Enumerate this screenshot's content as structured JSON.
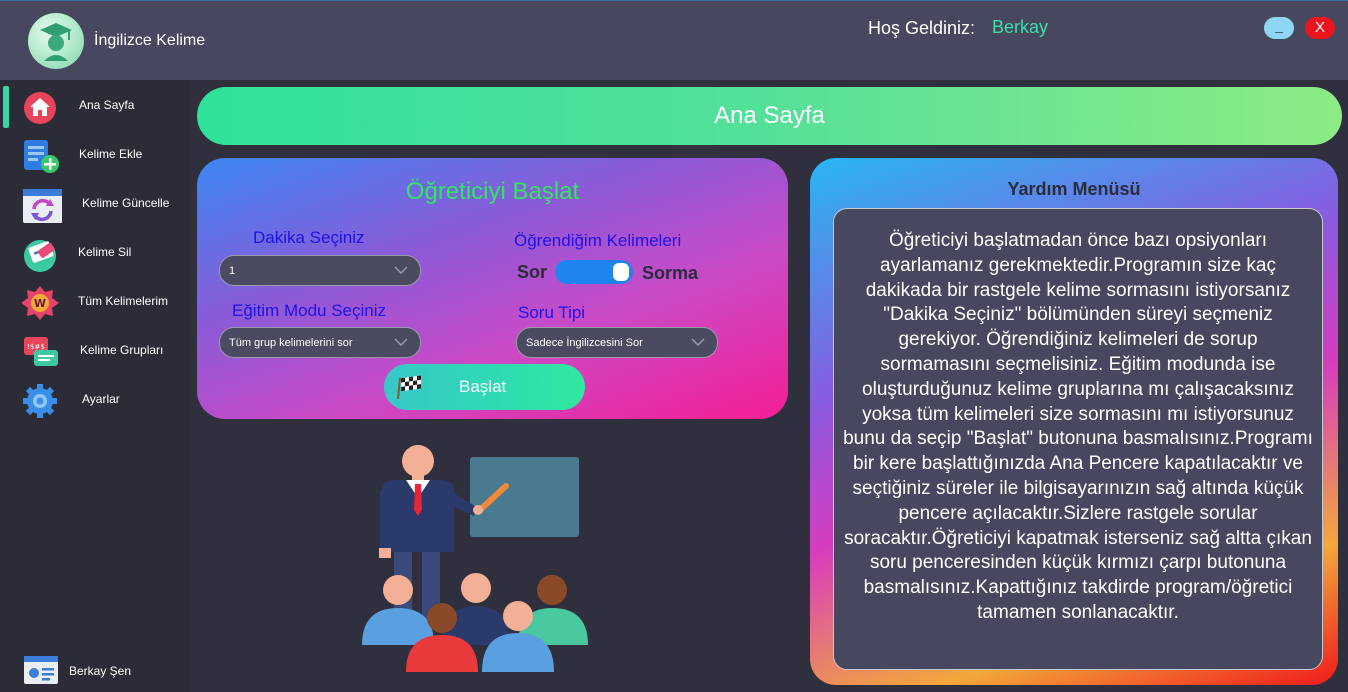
{
  "app": {
    "title": "İngilizce Kelime"
  },
  "header": {
    "welcome_label": "Hoş Geldiniz:",
    "username": "Berkay",
    "minimize_label": "_",
    "close_label": "X"
  },
  "sidebar": {
    "items": [
      {
        "label": "Ana Sayfa",
        "icon": "home-icon"
      },
      {
        "label": "Kelime Ekle",
        "icon": "add-word-icon"
      },
      {
        "label": "Kelime Güncelle",
        "icon": "update-icon"
      },
      {
        "label": "Kelime Sil",
        "icon": "delete-word-icon"
      },
      {
        "label": "Tüm Kelimelerim",
        "icon": "all-words-icon"
      },
      {
        "label": "Kelime Grupları",
        "icon": "word-groups-icon"
      },
      {
        "label": "Ayarlar",
        "icon": "gear-icon"
      }
    ],
    "footer_user": "Berkay Şen"
  },
  "page": {
    "title": "Ana Sayfa"
  },
  "start_panel": {
    "title": "Öğreticiyi Başlat",
    "minute_label": "Dakika Seçiniz",
    "minute_value": "1",
    "learned_label": "Öğrendiğim Kelimeleri",
    "toggle_left": "Sor",
    "toggle_right": "Sorma",
    "mode_label": "Eğitim Modu Seçiniz",
    "mode_value": "Tüm grup kelimelerini sor",
    "question_type_label": "Soru Tipi",
    "question_type_value": "Sadece İngilizcesini Sor",
    "start_button": "Başlat"
  },
  "help": {
    "title": "Yardım Menüsü",
    "text": "Öğreticiyi başlatmadan önce bazı opsiyonları ayarlamanız gerekmektedir.Programın size kaç dakikada bir rastgele kelime sormasını istiyorsanız \"Dakika Seçiniz\" bölümünden süreyi seçmeniz gerekiyor. Öğrendiğiniz kelimeleri de sorup sormamasını seçmelisiniz. Eğitim modunda ise oluşturduğunuz kelime gruplarına mı çalışacaksınız yoksa tüm kelimeleri size sormasını mı istiyorsunuz bunu da seçip \"Başlat\" butonuna basmalısınız.Programı bir kere başlattığınızda Ana Pencere kapatılacaktır ve seçtiğiniz süreler ile bilgisayarınızın sağ altında küçük pencere açılacaktır.Sizlere rastgele sorular soracaktır.Öğreticiyi kapatmak isterseniz sağ altta çıkan soru penceresinden küçük kırmızı çarpı butonuna basmalısınız.Kapattığınız takdirde program/öğretici tamamen sonlanacaktır."
  },
  "colors": {
    "accent": "#34d8a0",
    "titlebar": "#474760",
    "sidebar": "#2c2c39",
    "username": "#3ee0a7",
    "close": "#e8141e"
  }
}
